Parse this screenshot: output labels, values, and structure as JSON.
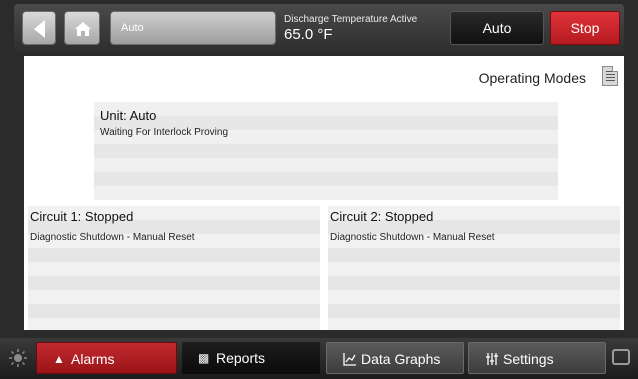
{
  "header": {
    "mode_button_label": "Auto",
    "discharge_label": "Discharge Temperature Active",
    "discharge_value": "65.0 °F",
    "auto_label": "Auto",
    "stop_label": "Stop"
  },
  "main": {
    "operating_modes_label": "Operating Modes",
    "unit": {
      "title": "Unit:  Auto",
      "status": "Waiting For Interlock Proving"
    },
    "circuits": [
      {
        "title": "Circuit 1:  Stopped",
        "status": "Diagnostic Shutdown - Manual Reset"
      },
      {
        "title": "Circuit 2:  Stopped",
        "status": "Diagnostic Shutdown - Manual Reset"
      }
    ]
  },
  "footer": {
    "tabs": [
      {
        "label": "Alarms",
        "icon": "alarm-icon"
      },
      {
        "label": "Reports",
        "icon": "report-icon"
      },
      {
        "label": "Data Graphs",
        "icon": "graph-icon"
      },
      {
        "label": "Settings",
        "icon": "settings-sliders-icon"
      }
    ]
  },
  "colors": {
    "stop": "#c9252b",
    "alarms_tab": "#b01f24",
    "topbar": "#3a3a3a"
  }
}
